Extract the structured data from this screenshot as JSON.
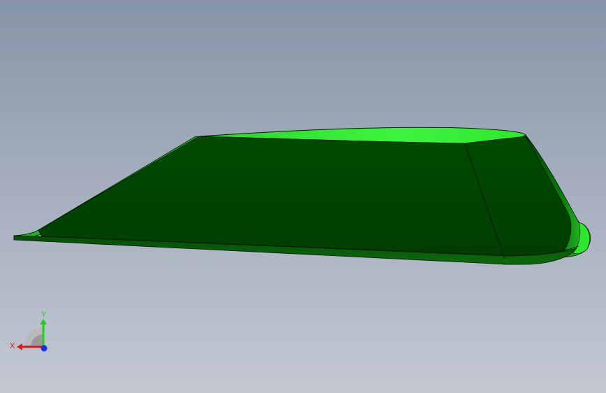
{
  "viewport": {
    "background_top": "#8795a8",
    "background_bottom": "#c3c8d2"
  },
  "model": {
    "shape": "wing-segment",
    "face_color_dark": "#004a00",
    "face_color_light": "#3df53d",
    "edge_color": "#001a00"
  },
  "triad": {
    "x_label": "X",
    "y_label": "Y",
    "x_color": "#e0141b",
    "y_color": "#19d119",
    "z_color": "#1a2ee6"
  }
}
